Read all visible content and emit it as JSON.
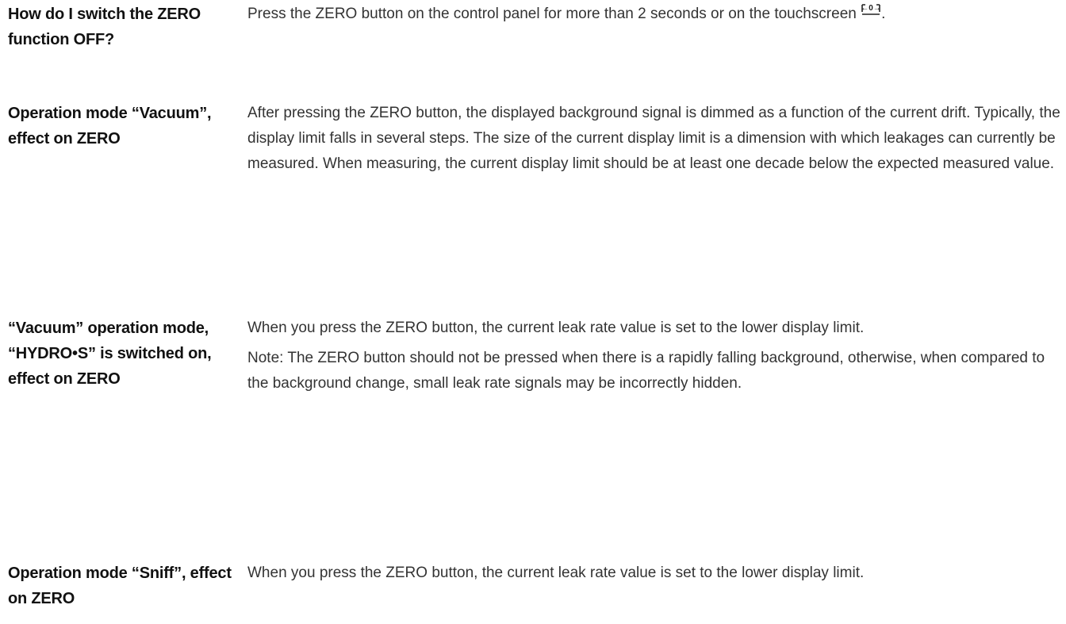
{
  "faq": [
    {
      "term": "How do I switch the ZERO function OFF?",
      "definition": [
        "Press the ZERO button on the control panel for more than 2 seconds or on the touchscreen"
      ],
      "trailing_period": "."
    },
    {
      "term": "Operation mode “Vacuum”, effect on ZERO",
      "definition": [
        "After pressing the ZERO button, the displayed background signal is dimmed as a function of the current drift. Typically, the display limit falls in several steps. The size of the current display limit is a dimension with which leakages can currently be measured. When measuring, the current display limit should be at least one decade below the expected measured value."
      ]
    },
    {
      "term": "“Vacuum” operation mode, “HYDRO•S” is switched on, effect on ZERO",
      "definition": [
        "When you press the ZERO button, the current leak rate value is set to the lower display limit.",
        "Note: The ZERO button should not be pressed when there is a rapidly falling background, otherwise, when compared to the background change, small leak rate signals may be incorrectly hidden."
      ]
    },
    {
      "term": "Operation mode “Sniff”, effect on ZERO",
      "definition": [
        "When you press the ZERO button, the current leak rate value is set to the lower display limit."
      ]
    }
  ],
  "icons": {
    "zero_icon": "zero-button-icon"
  }
}
